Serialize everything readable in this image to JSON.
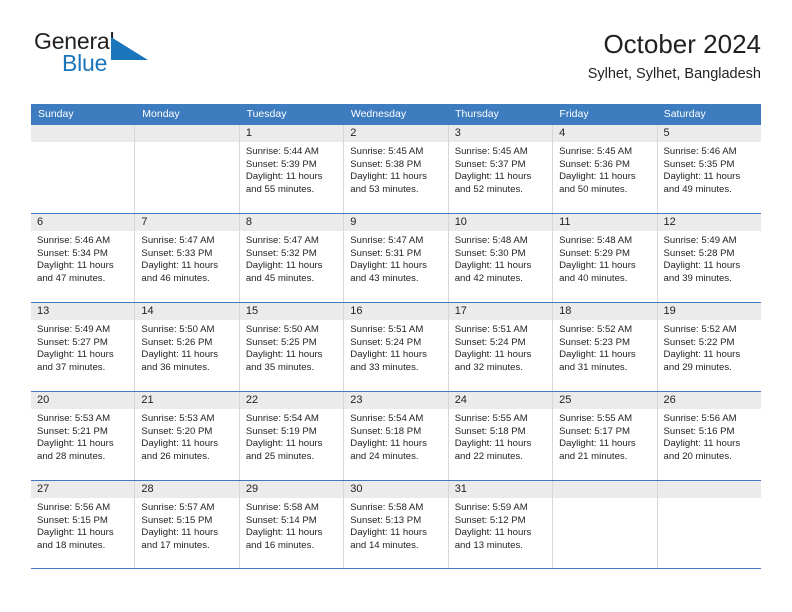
{
  "branding": {
    "name_part1": "General",
    "name_part2": "Blue",
    "accent_color": "#1b75bb",
    "triangle_icon": "triangle-logo-icon"
  },
  "header": {
    "title": "October 2024",
    "subtitle": "Sylhet, Sylhet, Bangladesh"
  },
  "calendar": {
    "header_bg": "#3c7cbf",
    "day_band_bg": "#ebebeb",
    "weekdays": [
      "Sunday",
      "Monday",
      "Tuesday",
      "Wednesday",
      "Thursday",
      "Friday",
      "Saturday"
    ],
    "weeks": [
      [
        {
          "day": "",
          "empty": true
        },
        {
          "day": "",
          "empty": true
        },
        {
          "day": "1",
          "sunrise": "Sunrise: 5:44 AM",
          "sunset": "Sunset: 5:39 PM",
          "daylight_line1": "Daylight: 11 hours",
          "daylight_line2": "and 55 minutes."
        },
        {
          "day": "2",
          "sunrise": "Sunrise: 5:45 AM",
          "sunset": "Sunset: 5:38 PM",
          "daylight_line1": "Daylight: 11 hours",
          "daylight_line2": "and 53 minutes."
        },
        {
          "day": "3",
          "sunrise": "Sunrise: 5:45 AM",
          "sunset": "Sunset: 5:37 PM",
          "daylight_line1": "Daylight: 11 hours",
          "daylight_line2": "and 52 minutes."
        },
        {
          "day": "4",
          "sunrise": "Sunrise: 5:45 AM",
          "sunset": "Sunset: 5:36 PM",
          "daylight_line1": "Daylight: 11 hours",
          "daylight_line2": "and 50 minutes."
        },
        {
          "day": "5",
          "sunrise": "Sunrise: 5:46 AM",
          "sunset": "Sunset: 5:35 PM",
          "daylight_line1": "Daylight: 11 hours",
          "daylight_line2": "and 49 minutes."
        }
      ],
      [
        {
          "day": "6",
          "sunrise": "Sunrise: 5:46 AM",
          "sunset": "Sunset: 5:34 PM",
          "daylight_line1": "Daylight: 11 hours",
          "daylight_line2": "and 47 minutes."
        },
        {
          "day": "7",
          "sunrise": "Sunrise: 5:47 AM",
          "sunset": "Sunset: 5:33 PM",
          "daylight_line1": "Daylight: 11 hours",
          "daylight_line2": "and 46 minutes."
        },
        {
          "day": "8",
          "sunrise": "Sunrise: 5:47 AM",
          "sunset": "Sunset: 5:32 PM",
          "daylight_line1": "Daylight: 11 hours",
          "daylight_line2": "and 45 minutes."
        },
        {
          "day": "9",
          "sunrise": "Sunrise: 5:47 AM",
          "sunset": "Sunset: 5:31 PM",
          "daylight_line1": "Daylight: 11 hours",
          "daylight_line2": "and 43 minutes."
        },
        {
          "day": "10",
          "sunrise": "Sunrise: 5:48 AM",
          "sunset": "Sunset: 5:30 PM",
          "daylight_line1": "Daylight: 11 hours",
          "daylight_line2": "and 42 minutes."
        },
        {
          "day": "11",
          "sunrise": "Sunrise: 5:48 AM",
          "sunset": "Sunset: 5:29 PM",
          "daylight_line1": "Daylight: 11 hours",
          "daylight_line2": "and 40 minutes."
        },
        {
          "day": "12",
          "sunrise": "Sunrise: 5:49 AM",
          "sunset": "Sunset: 5:28 PM",
          "daylight_line1": "Daylight: 11 hours",
          "daylight_line2": "and 39 minutes."
        }
      ],
      [
        {
          "day": "13",
          "sunrise": "Sunrise: 5:49 AM",
          "sunset": "Sunset: 5:27 PM",
          "daylight_line1": "Daylight: 11 hours",
          "daylight_line2": "and 37 minutes."
        },
        {
          "day": "14",
          "sunrise": "Sunrise: 5:50 AM",
          "sunset": "Sunset: 5:26 PM",
          "daylight_line1": "Daylight: 11 hours",
          "daylight_line2": "and 36 minutes."
        },
        {
          "day": "15",
          "sunrise": "Sunrise: 5:50 AM",
          "sunset": "Sunset: 5:25 PM",
          "daylight_line1": "Daylight: 11 hours",
          "daylight_line2": "and 35 minutes."
        },
        {
          "day": "16",
          "sunrise": "Sunrise: 5:51 AM",
          "sunset": "Sunset: 5:24 PM",
          "daylight_line1": "Daylight: 11 hours",
          "daylight_line2": "and 33 minutes."
        },
        {
          "day": "17",
          "sunrise": "Sunrise: 5:51 AM",
          "sunset": "Sunset: 5:24 PM",
          "daylight_line1": "Daylight: 11 hours",
          "daylight_line2": "and 32 minutes."
        },
        {
          "day": "18",
          "sunrise": "Sunrise: 5:52 AM",
          "sunset": "Sunset: 5:23 PM",
          "daylight_line1": "Daylight: 11 hours",
          "daylight_line2": "and 31 minutes."
        },
        {
          "day": "19",
          "sunrise": "Sunrise: 5:52 AM",
          "sunset": "Sunset: 5:22 PM",
          "daylight_line1": "Daylight: 11 hours",
          "daylight_line2": "and 29 minutes."
        }
      ],
      [
        {
          "day": "20",
          "sunrise": "Sunrise: 5:53 AM",
          "sunset": "Sunset: 5:21 PM",
          "daylight_line1": "Daylight: 11 hours",
          "daylight_line2": "and 28 minutes."
        },
        {
          "day": "21",
          "sunrise": "Sunrise: 5:53 AM",
          "sunset": "Sunset: 5:20 PM",
          "daylight_line1": "Daylight: 11 hours",
          "daylight_line2": "and 26 minutes."
        },
        {
          "day": "22",
          "sunrise": "Sunrise: 5:54 AM",
          "sunset": "Sunset: 5:19 PM",
          "daylight_line1": "Daylight: 11 hours",
          "daylight_line2": "and 25 minutes."
        },
        {
          "day": "23",
          "sunrise": "Sunrise: 5:54 AM",
          "sunset": "Sunset: 5:18 PM",
          "daylight_line1": "Daylight: 11 hours",
          "daylight_line2": "and 24 minutes."
        },
        {
          "day": "24",
          "sunrise": "Sunrise: 5:55 AM",
          "sunset": "Sunset: 5:18 PM",
          "daylight_line1": "Daylight: 11 hours",
          "daylight_line2": "and 22 minutes."
        },
        {
          "day": "25",
          "sunrise": "Sunrise: 5:55 AM",
          "sunset": "Sunset: 5:17 PM",
          "daylight_line1": "Daylight: 11 hours",
          "daylight_line2": "and 21 minutes."
        },
        {
          "day": "26",
          "sunrise": "Sunrise: 5:56 AM",
          "sunset": "Sunset: 5:16 PM",
          "daylight_line1": "Daylight: 11 hours",
          "daylight_line2": "and 20 minutes."
        }
      ],
      [
        {
          "day": "27",
          "sunrise": "Sunrise: 5:56 AM",
          "sunset": "Sunset: 5:15 PM",
          "daylight_line1": "Daylight: 11 hours",
          "daylight_line2": "and 18 minutes."
        },
        {
          "day": "28",
          "sunrise": "Sunrise: 5:57 AM",
          "sunset": "Sunset: 5:15 PM",
          "daylight_line1": "Daylight: 11 hours",
          "daylight_line2": "and 17 minutes."
        },
        {
          "day": "29",
          "sunrise": "Sunrise: 5:58 AM",
          "sunset": "Sunset: 5:14 PM",
          "daylight_line1": "Daylight: 11 hours",
          "daylight_line2": "and 16 minutes."
        },
        {
          "day": "30",
          "sunrise": "Sunrise: 5:58 AM",
          "sunset": "Sunset: 5:13 PM",
          "daylight_line1": "Daylight: 11 hours",
          "daylight_line2": "and 14 minutes."
        },
        {
          "day": "31",
          "sunrise": "Sunrise: 5:59 AM",
          "sunset": "Sunset: 5:12 PM",
          "daylight_line1": "Daylight: 11 hours",
          "daylight_line2": "and 13 minutes."
        },
        {
          "day": "",
          "empty": true
        },
        {
          "day": "",
          "empty": true
        }
      ]
    ]
  }
}
